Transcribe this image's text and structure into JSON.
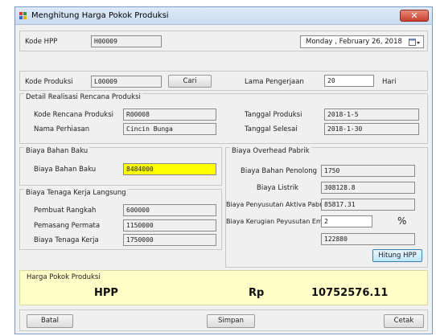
{
  "window": {
    "title": "Menghitung Harga Pokok Produksi",
    "close_icon": "close-icon"
  },
  "header": {
    "kode_hpp_label": "Kode HPP",
    "kode_hpp_value": "H00009",
    "date_value": "Monday   ,  February  26, 2018"
  },
  "produksi": {
    "kode_label": "Kode Produksi",
    "kode_value": "L00009",
    "cari_label": "Cari",
    "lama_label": "Lama Pengerjaan",
    "lama_value": "20",
    "lama_unit": "Hari"
  },
  "detail": {
    "group_title": "Detail Realisasi Rencana Produksi",
    "kode_rencana_label": "Kode Rencana Produksi",
    "kode_rencana_value": "R00008",
    "nama_label": "Nama Perhiasan",
    "nama_value": "Cincin Bunga",
    "tgl_produksi_label": "Tanggal Produksi",
    "tgl_produksi_value": "2018-1-5",
    "tgl_selesai_label": "Tanggal Selesai",
    "tgl_selesai_value": "2018-1-30"
  },
  "bahan_baku": {
    "group_title": "Biaya Bahan Baku",
    "label": "Biaya Bahan Baku",
    "value": "8484000"
  },
  "tenaga_kerja": {
    "group_title": "Biaya Tenaga Kerja Langsung",
    "rangkah_label": "Pembuat Rangkah",
    "rangkah_value": "600000",
    "permata_label": "Pemasang Permata",
    "permata_value": "1150000",
    "total_label": "Biaya Tenaga Kerja",
    "total_value": "1750000"
  },
  "overhead": {
    "group_title": "Biaya Overhead Pabrik",
    "penolong_label": "Biaya Bahan Penolong",
    "penolong_value": "1750",
    "listrik_label": "Biaya Listrik",
    "listrik_value": "308128.8",
    "penyusutan_label": "Biaya Penyusutan Aktiva Pabrik",
    "penyusutan_value": "85817.31",
    "kerugian_label": "Biaya Kerugian Peyusutan Emas",
    "kerugian_value": "2",
    "percent": "%",
    "kerugian_result": "122880",
    "hitung_label": "Hitung HPP"
  },
  "hpp": {
    "group_title": "Harga Pokok Produksi",
    "label": "HPP",
    "currency": "Rp",
    "value": "10752576.11"
  },
  "footer": {
    "batal_label": "Batal",
    "simpan_label": "Simpan",
    "cetak_label": "Cetak"
  }
}
